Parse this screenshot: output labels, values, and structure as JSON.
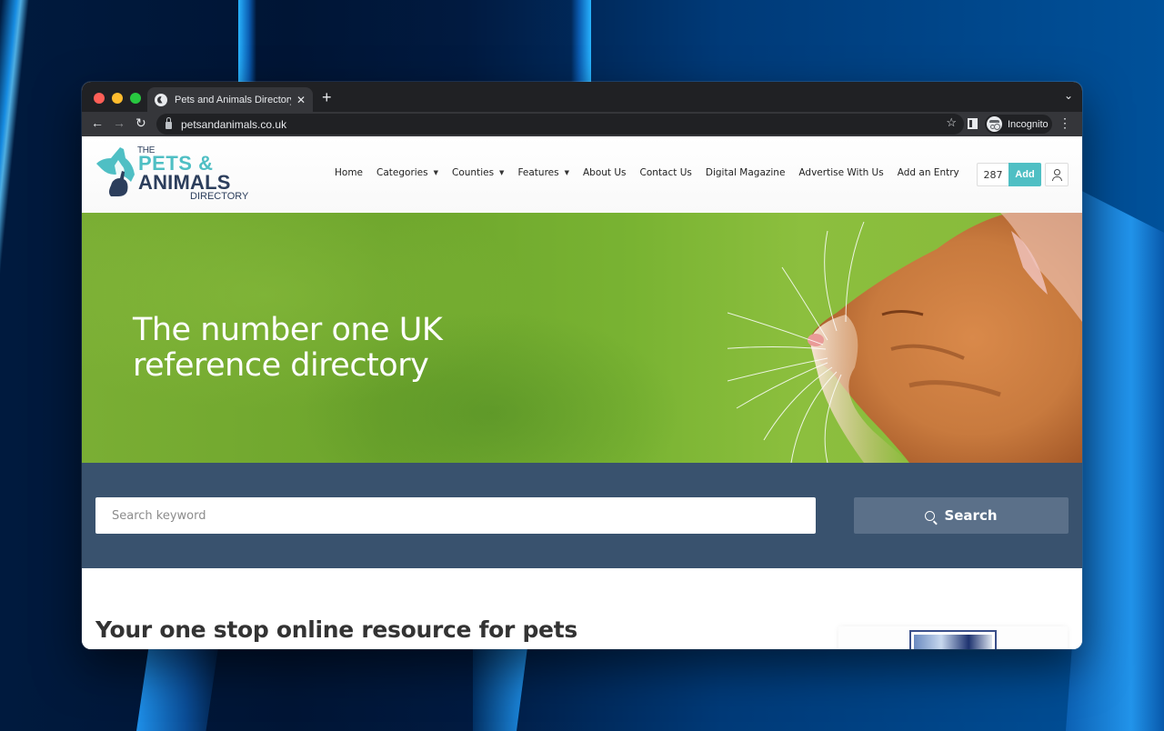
{
  "browser": {
    "tab": {
      "title": "Pets and Animals Directory Portal",
      "icon": "globe-icon"
    },
    "new_tab_label": "+",
    "url": "petsandanimals.co.uk",
    "profile_label": "Incognito",
    "icons": {
      "back": "←",
      "forward": "→",
      "reload": "↻",
      "star": "☆",
      "close": "✕",
      "tab_menu": "⌄",
      "menu": "⋮"
    }
  },
  "site": {
    "logo": {
      "the": "THE",
      "line1": "PETS &",
      "line2": "ANIMALS",
      "line3": "DIRECTORY"
    },
    "nav": [
      {
        "label": "Home",
        "dropdown": false
      },
      {
        "label": "Categories",
        "dropdown": true
      },
      {
        "label": "Counties",
        "dropdown": true
      },
      {
        "label": "Features",
        "dropdown": true
      },
      {
        "label": "About Us",
        "dropdown": false
      },
      {
        "label": "Contact Us",
        "dropdown": false
      },
      {
        "label": "Digital Magazine",
        "dropdown": false
      },
      {
        "label": "Advertise With Us",
        "dropdown": false
      },
      {
        "label": "Add an Entry",
        "dropdown": false
      }
    ],
    "caret": "▼",
    "entry_count": "287",
    "add_label": "Add",
    "hero": {
      "title": "The number one UK reference directory"
    },
    "search": {
      "placeholder": "Search keyword",
      "value": "",
      "button_label": "Search"
    },
    "content": {
      "heading": "Your one stop online resource for pets"
    },
    "colors": {
      "brand_teal": "#4fbfc4",
      "brand_navy": "#2c3e5c",
      "search_band": "#39526e",
      "search_button": "#5b7089"
    }
  }
}
